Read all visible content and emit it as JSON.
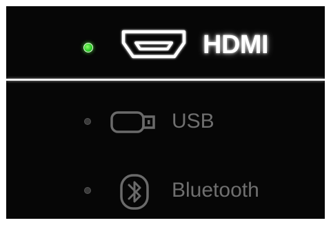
{
  "inputs": [
    {
      "label": "HDMI",
      "icon": "hdmi-port-icon",
      "selected": true,
      "indicator_color": "#3ad632"
    },
    {
      "label": "USB",
      "icon": "usb-drive-icon",
      "selected": false,
      "indicator_color": "#3a3a3a"
    },
    {
      "label": "Bluetooth",
      "icon": "bluetooth-icon",
      "selected": false,
      "indicator_color": "#3a3a3a"
    }
  ],
  "colors": {
    "background": "#060606",
    "active_text": "#ffffff",
    "inactive_text": "#6f6f6f",
    "divider": "#f4f4f4"
  }
}
